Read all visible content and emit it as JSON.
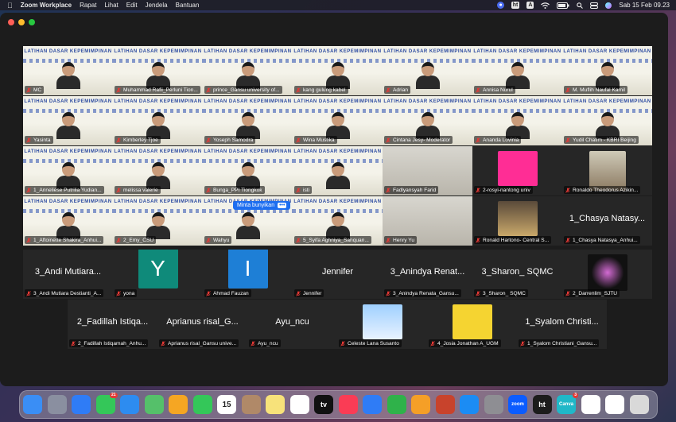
{
  "menubar": {
    "apple": "",
    "app_name": "Zoom Workplace",
    "items": [
      "Rapat",
      "Lihat",
      "Edit",
      "Jendela",
      "Bantuan"
    ],
    "status_badge_1": "ht",
    "status_badge_2": "A",
    "clock": "Sab 15 Feb  09.23"
  },
  "meeting": {
    "banner_text": "LATIHAN DASAR KEPEMIMPINAN",
    "popup_label": "Minta bunyikan",
    "popup_more": "•••",
    "participants": [
      "MC",
      "Muhammad Rafii_Perluni Tion...",
      "prince_Gansu university of...",
      "kang gulung kabel",
      "Adrian",
      "Annisa Nurul",
      "M. Muflih Naufal Kamil",
      "Yasinta",
      "Kimberley Tjoe",
      "Yoseph Samodra",
      "Wina Mustika",
      "Cintana Jesy- Moderator",
      "Ananda Lovinia",
      "Yudil Chatim - KBRI Beijing",
      "1_Anneliese Putrilia Yudian...",
      "melissa valerie",
      "Bunga_PPI Tiongkok",
      "isti",
      "Fadlyansyah Farid",
      "2-rosyi-nantong univ",
      "Ronaldo Theodorus Azikin...",
      "1_Aftoinette Shakira_Anhui...",
      "2_Emy_CSU",
      "Wahyu",
      "5_Syifa Aghniya_Sanquan...",
      "Henry Yu",
      "Ronald Hartono- Central S...",
      "1_Chasya Natasya_Anhui...",
      "3_Andi Mutiara Destianti_A...",
      "yona",
      "Ahmad Fauzan",
      "Jennifer",
      "3_Anindya Renata_Gansu...",
      "3_Sharon_ SQMC",
      "2_Darrenlim_SJTU",
      "2_Fadillah Istiqamah_Anhu...",
      "Aprianus risal_Gansu unive...",
      "Ayu_ncu",
      "Celeste Lana Susanto",
      "4_Josia Jonathan A_UGM",
      "1_Syalom Christiani_Gansu..."
    ],
    "big_names": {
      "chasya": "1_Chasya Natasy...",
      "andi": "3_Andi Mutiara...",
      "jennifer": "Jennifer",
      "anindya": "3_Anindya Renat...",
      "sharon": "3_Sharon_ SQMC",
      "fadillah": "2_Fadillah Istiqa...",
      "aprianus": "Aprianus risal_G...",
      "ayu": "Ayu_ncu",
      "syalom": "1_Syalom Christi..."
    },
    "avatars": {
      "yona": "Y",
      "ahmad": "I"
    },
    "colors": {
      "avatar_yona": "#0f8a7a",
      "avatar_ahmad": "#1e7fd6",
      "muted_mic": "#e53935",
      "popup_accent": "#1d6ef0"
    }
  },
  "dock": {
    "calendar_month": "FEB",
    "calendar_day": "15",
    "messages_badge": "21",
    "appletv_label": "tv",
    "zoom_label": "zoom",
    "ht_label": "ht",
    "canva_label": "Canva",
    "canva_badge": "3",
    "icons": [
      "finder",
      "launchpad",
      "safari",
      "messages",
      "mail",
      "maps",
      "photos",
      "facetime",
      "calendar",
      "contacts",
      "notes",
      "freeform",
      "appletv",
      "music",
      "keynote",
      "numbers",
      "pages",
      "powerpoint",
      "appstore",
      "settings",
      "zoom",
      "ht",
      "canva",
      "preview",
      "screenshot",
      "trash"
    ]
  }
}
